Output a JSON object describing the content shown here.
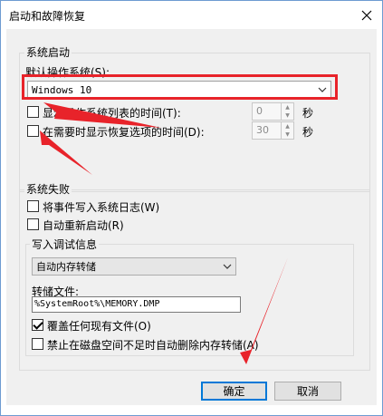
{
  "window": {
    "title": "启动和故障恢复"
  },
  "system_startup": {
    "group_title": "系统启动",
    "default_os_label": "默认操作系统(S):",
    "default_os_value": "Windows 10",
    "show_os_list_label": "显示操作系统列表的时间(T):",
    "show_os_list_value": "0",
    "show_recovery_label": "在需要时显示恢复选项的时间(D):",
    "show_recovery_value": "30",
    "seconds_unit": "秒"
  },
  "system_failure": {
    "group_title": "系统失败",
    "write_event_label": "将事件写入系统日志(W)",
    "auto_restart_label": "自动重新启动(R)",
    "debug_info": {
      "group_title": "写入调试信息",
      "dump_type_value": "自动内存转储",
      "dump_file_label": "转储文件:",
      "dump_file_value": "%SystemRoot%\\MEMORY.DMP",
      "overwrite_label": "覆盖任何现有文件(O)",
      "disable_auto_delete_label": "禁止在磁盘空间不足时自动删除内存转储(A)"
    }
  },
  "buttons": {
    "ok_label": "确定",
    "cancel_label": "取消"
  },
  "colors": {
    "annotation_red": "#e8232a",
    "focus_blue": "#0078d7"
  }
}
